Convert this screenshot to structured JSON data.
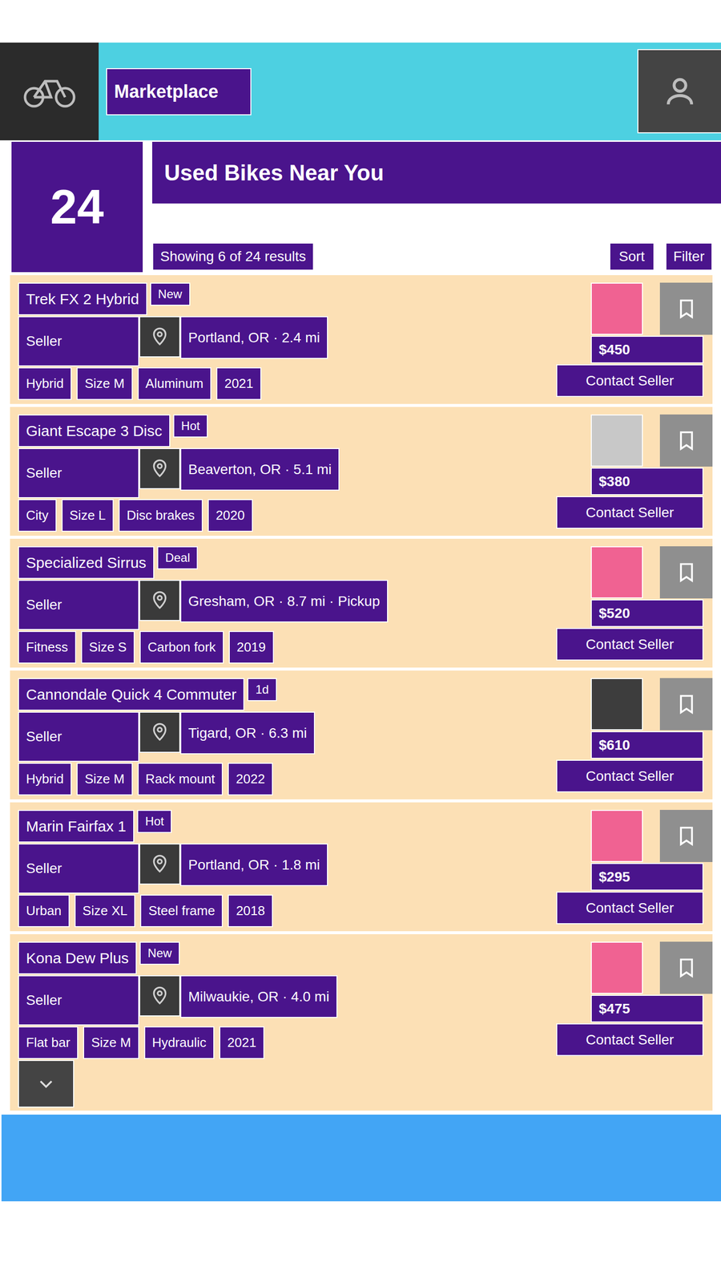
{
  "header": {
    "title": "Marketplace"
  },
  "summary": {
    "count": "24",
    "heading": "Used Bikes Near You",
    "subtitle": "Showing 6 of 24 results",
    "buttons": [
      "Sort",
      "Filter"
    ]
  },
  "listings": [
    {
      "title": "Trek FX 2 Hybrid",
      "badge": "New",
      "seller": "Seller",
      "location": "Portland, OR · 2.4 mi",
      "tags": [
        "Hybrid",
        "Size M",
        "Aluminum",
        "2021"
      ],
      "price": "$450",
      "action": "Contact Seller",
      "color": "#f06292"
    },
    {
      "title": "Giant Escape 3 Disc",
      "badge": "Hot",
      "seller": "Seller",
      "location": "Beaverton, OR · 5.1 mi",
      "tags": [
        "City",
        "Size L",
        "Disc brakes",
        "2020"
      ],
      "price": "$380",
      "action": "Contact Seller",
      "color": "#c8c8c8"
    },
    {
      "title": "Specialized Sirrus",
      "badge": "Deal",
      "seller": "Seller",
      "location": "Gresham, OR · 8.7 mi · Pickup",
      "tags": [
        "Fitness",
        "Size S",
        "Carbon fork",
        "2019"
      ],
      "price": "$520",
      "action": "Contact Seller",
      "color": "#f06292"
    },
    {
      "title": "Cannondale Quick 4 Commuter",
      "badge": "1d",
      "seller": "Seller",
      "location": "Tigard, OR · 6.3 mi",
      "tags": [
        "Hybrid",
        "Size M",
        "Rack mount",
        "2022"
      ],
      "price": "$610",
      "action": "Contact Seller",
      "color": "#3d3d3d"
    },
    {
      "title": "Marin Fairfax 1",
      "badge": "Hot",
      "seller": "Seller",
      "location": "Portland, OR · 1.8 mi",
      "tags": [
        "Urban",
        "Size XL",
        "Steel frame",
        "2018"
      ],
      "price": "$295",
      "action": "Contact Seller",
      "color": "#f06292"
    },
    {
      "title": "Kona Dew Plus",
      "badge": "New",
      "seller": "Seller",
      "location": "Milwaukie, OR · 4.0 mi",
      "tags": [
        "Flat bar",
        "Size M",
        "Hydraulic",
        "2021"
      ],
      "price": "$475",
      "action": "Contact Seller",
      "color": "#f06292"
    }
  ]
}
